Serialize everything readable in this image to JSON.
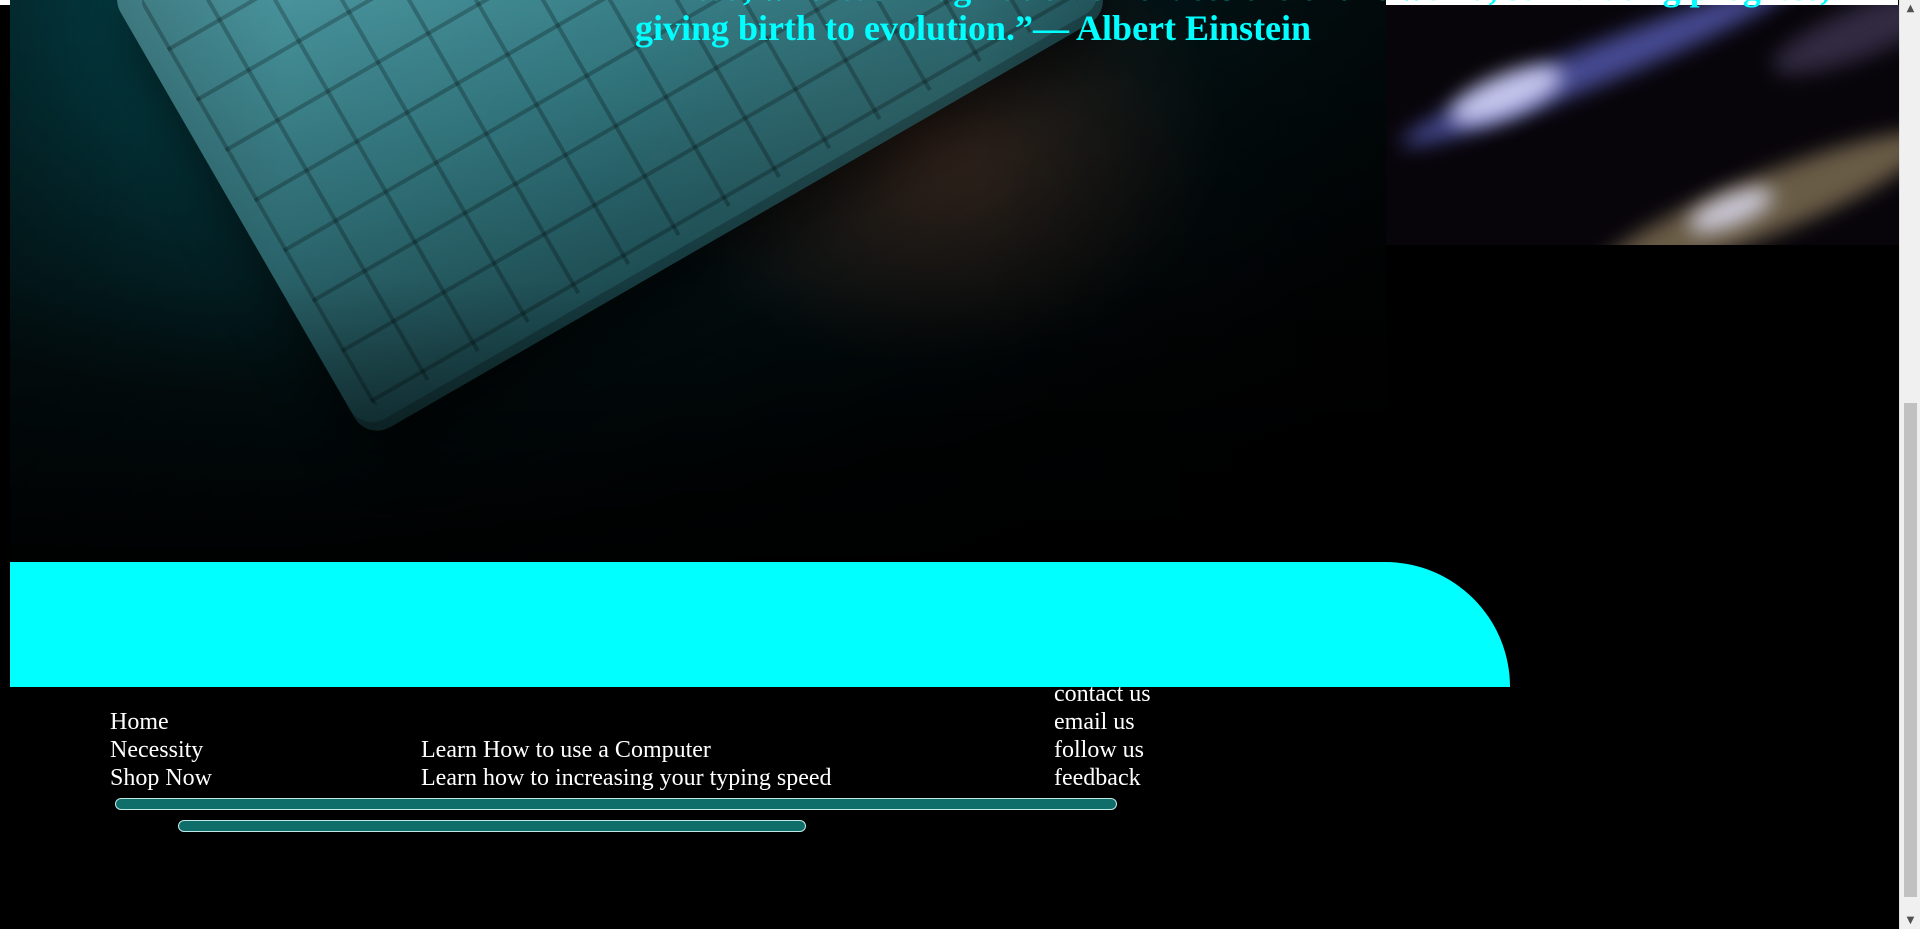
{
  "hero": {
    "quote": "limited, whereas imagination embraces the entire world, stimulating progress, giving birth to evolution.”— Albert Einstein"
  },
  "footer": {
    "nav": [
      "Home",
      "Necessity",
      "Shop Now"
    ],
    "learn": [
      "Learn How to use a Computer",
      "Learn how to increasing your typing speed"
    ],
    "contact": [
      "contact us",
      "email us",
      "follow us",
      "feedback"
    ]
  },
  "scrollbar": {
    "up_icon": "triangle-up-icon",
    "down_icon": "triangle-down-icon"
  },
  "colors": {
    "accent": "#00ffff",
    "background": "#000000",
    "bar_fill": "#0f6e6a",
    "footer_text": "#ffffff"
  }
}
